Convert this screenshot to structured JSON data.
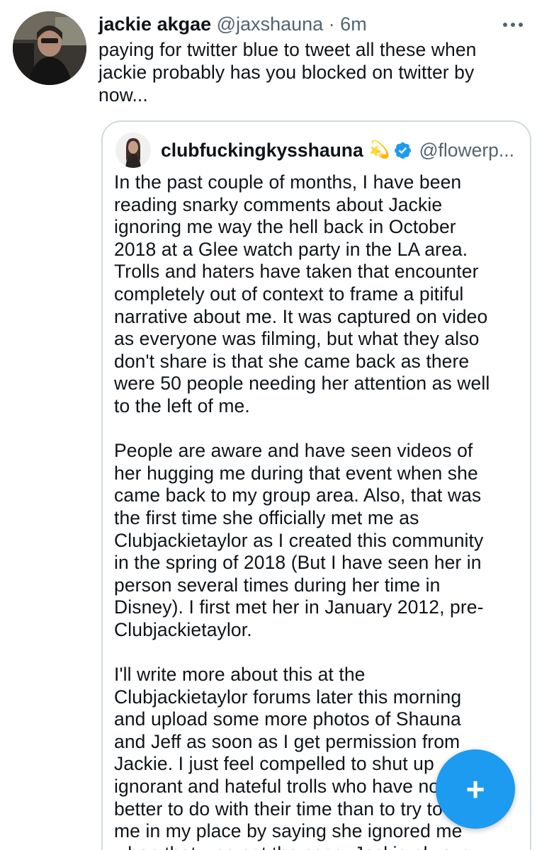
{
  "tweet": {
    "author_name": "jackie akgae",
    "author_handle": "@jaxshauna",
    "separator": " · ",
    "timestamp": "6m",
    "text": "paying for twitter blue to tweet all these when\njackie probably has you blocked on twitter by\nnow...",
    "more_icon": "more-horizontal-icon"
  },
  "quoted_tweet": {
    "author_name": "clubfuckingkysshauna",
    "emoji": "💫",
    "verified_icon": "verified-badge-icon",
    "author_handle": "@flowerp...",
    "text": "In the past couple of months, I have been\nreading snarky comments about Jackie\nignoring me way the hell back in October\n2018 at a Glee watch party in the LA area.\nTrolls and haters have taken that encounter\ncompletely out of context to frame a pitiful\nnarrative about me. It was captured on video\nas everyone was filming, but what they also\ndon't share is that she came back as there\nwere 50 people needing her attention as well\nto the left of me.\n\nPeople are aware and have seen videos of\nher hugging me during that event when she\ncame back to my group area. Also, that was\nthe first time she officially met me as\nClubjackietaylor as I created this community\nin the spring of 2018 (But I have seen her in\nperson several times during her time in\nDisney). I first met her in January 2012, pre-\nClubjackietaylor.\n\nI'll write more about this at the\nClubjackietaylor forums later this morning\nand upload some more photos of Shauna\nand Jeff as soon as I get permission from\nJackie. I just feel compelled to shut up\nignorant and hateful trolls who have no\nbetter to do with their time than to try to\nme in my place by saying she ignored me\nwhen that was not the case. Jackie always"
  },
  "fab": {
    "label": "+",
    "icon": "compose-plus-icon"
  },
  "colors": {
    "primary_text": "#0f1419",
    "secondary_text": "#536471",
    "border": "#cfd9de",
    "accent": "#1d9bf0"
  }
}
